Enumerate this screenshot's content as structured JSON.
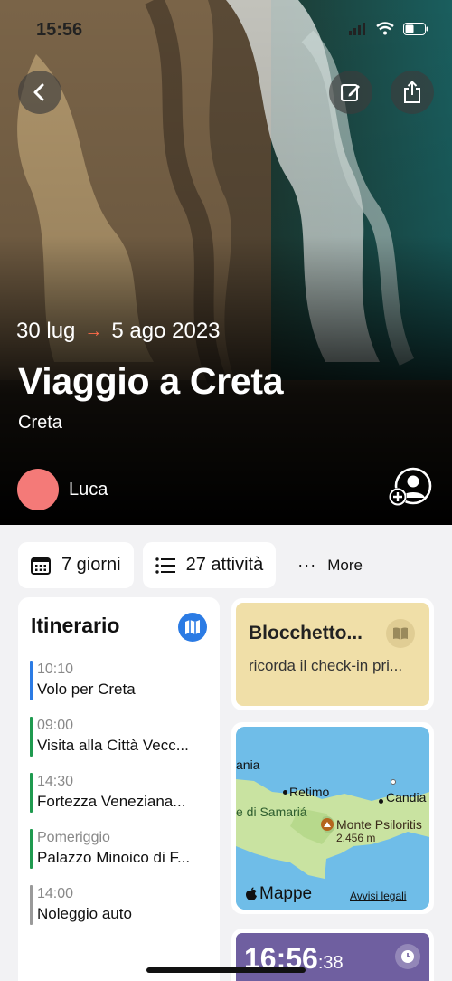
{
  "status_bar": {
    "time": "15:56"
  },
  "hero": {
    "date_start": "30 lug",
    "date_arrow": "→",
    "date_end": "5 ago 2023",
    "title": "Viaggio a Creta",
    "subtitle": "Creta",
    "owner_name": "Luca",
    "owner_color": "#f47a78"
  },
  "chips": [
    {
      "label": "7 giorni",
      "icon": "calendar-icon"
    },
    {
      "label": "27 attività",
      "icon": "list-icon"
    },
    {
      "label": "More",
      "icon": "ellipsis-icon"
    }
  ],
  "itinerary": {
    "title": "Itinerario",
    "items": [
      {
        "time": "10:10",
        "name": "Volo per Creta",
        "color": "#2b7be4"
      },
      {
        "time": "09:00",
        "name": "Visita alla Città Vecc...",
        "color": "#1f9a4f"
      },
      {
        "time": "14:30",
        "name": "Fortezza Veneziana...",
        "color": "#1f9a4f"
      },
      {
        "time": "Pomeriggio",
        "name": "Palazzo Minoico di F...",
        "color": "#1f9a4f"
      },
      {
        "time": "14:00",
        "name": "Noleggio auto",
        "color": "#9a9a9a"
      }
    ]
  },
  "note": {
    "title": "Blocchetto...",
    "body": "ricorda il check-in pri..."
  },
  "map": {
    "labels": {
      "chania": "ania",
      "rethymno": "Retimo",
      "heraklion": "Candia",
      "samaria": "e di Samariá",
      "psiloritis": "Monte Psiloritis",
      "psiloritis_alt": "2.456 m"
    },
    "logo_text": "Mappe",
    "legal": "Avvisi legali"
  },
  "clock": {
    "time": "16:56",
    "seconds": ":38"
  },
  "colors": {
    "accent": "#2b7be4",
    "note_bg": "#f0dfa8",
    "clock_bg": "#6f5fa0",
    "arrow": "#ff6b4a"
  }
}
